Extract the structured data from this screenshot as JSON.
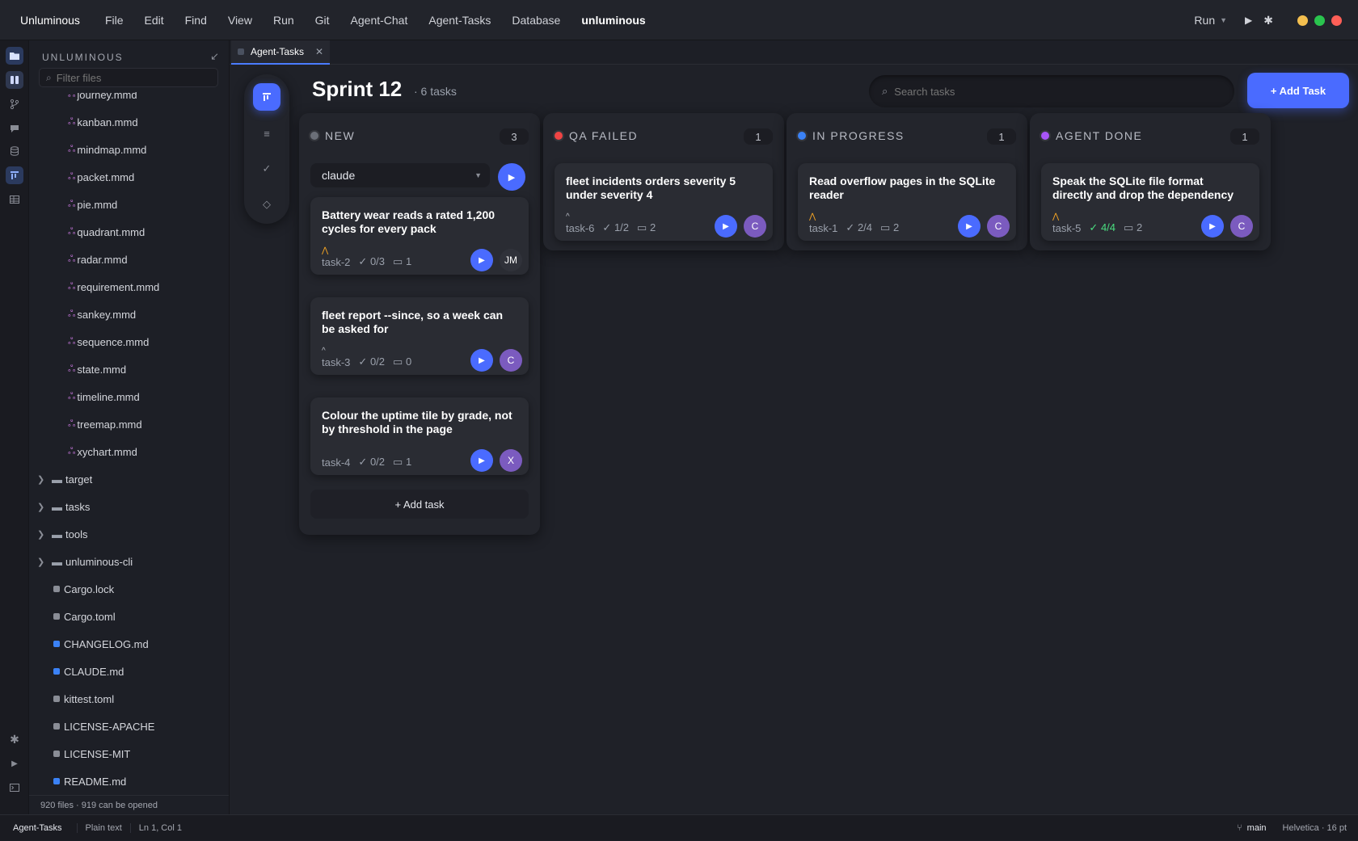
{
  "menubar": {
    "app": "Unluminous",
    "items": [
      "File",
      "Edit",
      "Find",
      "View",
      "Run",
      "Git",
      "Agent-Chat",
      "Agent-Tasks",
      "Database"
    ],
    "project": "unluminous",
    "run_label": "Run",
    "traffic_colors": [
      "#f4bf4f",
      "#2ac44e",
      "#ff5f57"
    ]
  },
  "sidebar": {
    "title": "UNLUMINOUS",
    "filter_placeholder": "Filter files",
    "mmd_files": [
      "journey.mmd",
      "kanban.mmd",
      "mindmap.mmd",
      "packet.mmd",
      "pie.mmd",
      "quadrant.mmd",
      "radar.mmd",
      "requirement.mmd",
      "sankey.mmd",
      "sequence.mmd",
      "state.mmd",
      "timeline.mmd",
      "treemap.mmd",
      "xychart.mmd"
    ],
    "folders": [
      "target",
      "tasks",
      "tools",
      "unluminous-cli"
    ],
    "files": [
      {
        "name": "Cargo.lock",
        "color": "#8a8d96"
      },
      {
        "name": "Cargo.toml",
        "color": "#8a8d96"
      },
      {
        "name": "CHANGELOG.md",
        "color": "#3b82f6"
      },
      {
        "name": "CLAUDE.md",
        "color": "#3b82f6"
      },
      {
        "name": "kittest.toml",
        "color": "#8a8d96"
      },
      {
        "name": "LICENSE-APACHE",
        "color": "#8a8d96"
      },
      {
        "name": "LICENSE-MIT",
        "color": "#8a8d96"
      },
      {
        "name": "README.md",
        "color": "#3b82f6"
      }
    ],
    "status": "920 files  ·  919 can be opened"
  },
  "tab": {
    "label": "Agent-Tasks"
  },
  "board": {
    "title": "Sprint 12",
    "subtitle": "· 6 tasks",
    "search_placeholder": "Search tasks",
    "add_task": "+ Add Task",
    "add_task_row": "+ Add task",
    "agent": "claude",
    "columns": [
      {
        "name": "NEW",
        "count": "3",
        "dot": "#6b6f78",
        "cards": [
          {
            "title": "Battery wear reads a rated 1,200 cycles for every pack",
            "prio": "high",
            "prio_symbol": "⋀",
            "id": "task-2",
            "checks": "0/3",
            "comments": "1",
            "avatar": "JM",
            "avatar_color": "#30323a"
          },
          {
            "title": "fleet report --since, so a week can be asked for",
            "prio": "low",
            "prio_symbol": "^",
            "id": "task-3",
            "checks": "0/2",
            "comments": "0",
            "avatar": "C",
            "avatar_color": "#7b5bbf"
          },
          {
            "title": "Colour the uptime tile by grade, not by threshold in the page",
            "prio": "none",
            "prio_symbol": "",
            "id": "task-4",
            "checks": "0/2",
            "comments": "1",
            "avatar": "X",
            "avatar_color": "#7b5bbf"
          }
        ]
      },
      {
        "name": "QA FAILED",
        "count": "1",
        "dot": "#ef4444",
        "cards": [
          {
            "title": "fleet incidents orders severity 5 under severity 4",
            "prio": "low",
            "prio_symbol": "^",
            "id": "task-6",
            "checks": "1/2",
            "comments": "2",
            "avatar": "C",
            "avatar_color": "#7b5bbf"
          }
        ]
      },
      {
        "name": "IN PROGRESS",
        "count": "1",
        "dot": "#3b82f6",
        "cards": [
          {
            "title": "Read overflow pages in the SQLite reader",
            "prio": "high",
            "prio_symbol": "⋀",
            "id": "task-1",
            "checks": "2/4",
            "comments": "2",
            "avatar": "C",
            "avatar_color": "#7b5bbf"
          }
        ]
      },
      {
        "name": "AGENT DONE",
        "count": "1",
        "dot": "#a855f7",
        "cards": [
          {
            "title": "Speak the SQLite file format directly and drop the dependency",
            "prio": "high",
            "prio_symbol": "⋀",
            "id": "task-5",
            "checks": "4/4",
            "comments": "2",
            "avatar": "C",
            "avatar_color": "#7b5bbf",
            "checks_done": true
          }
        ]
      }
    ]
  },
  "statusbar": {
    "items": [
      "Agent-Tasks",
      "Plain text",
      "Ln 1, Col 1"
    ],
    "branch": "main",
    "font": "Helvetica · 16 pt"
  }
}
